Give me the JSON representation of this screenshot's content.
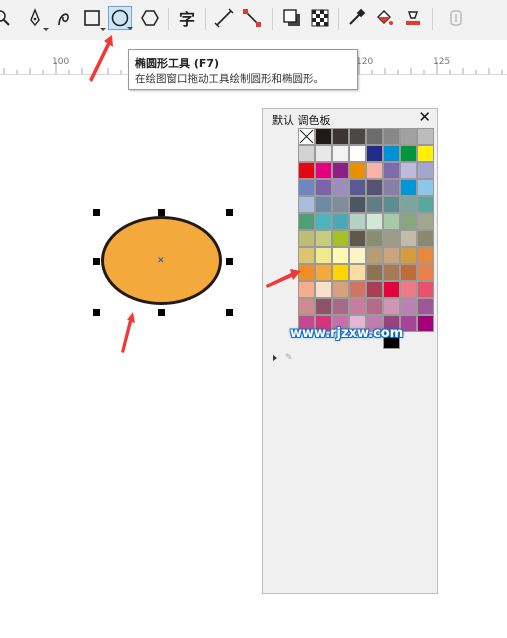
{
  "toolbar": {
    "icons": [
      "zoom-tool",
      "freehand-tool",
      "artistic-media-tool",
      "rectangle-tool",
      "ellipse-tool",
      "polygon-tool",
      "text-tool",
      "parallel-dimension-tool",
      "connector-tool",
      "drop-shadow-tool",
      "transparency-tool",
      "color-eyedropper-tool",
      "interactive-fill-tool",
      "smart-fill-tool",
      "object-lock"
    ],
    "text_tool_glyph": "字",
    "active_tool": "ellipse-tool"
  },
  "ruler": {
    "ticks": [
      "100",
      "120",
      "125"
    ]
  },
  "tooltip": {
    "title": "椭圆形工具 (F7)",
    "description": "在绘图窗口拖动工具绘制圆形和椭圆形。"
  },
  "shape": {
    "fill": "#f4a93c",
    "outline": "#221a14"
  },
  "palette_panel": {
    "title": "默认 调色板",
    "close": "✕",
    "rows": [
      [
        "none",
        "#1f1a17",
        "#3b3634",
        "#4b4847",
        "#6d6c6c",
        "#888787",
        "#a2a1a1",
        "#bcbcbc"
      ],
      [
        "#d2d2d2",
        "#e8e8e8",
        "#f3f3f3",
        "#ffffff",
        "#1e2d89",
        "#0091d5",
        "#00973c",
        "#fff100"
      ],
      [
        "#e30613",
        "#e5007e",
        "#8b2282",
        "#ea8f00",
        "#f5b3a9",
        "#7e6bab",
        "#bfb9dc",
        "#a4a6cf"
      ],
      [
        "#6f86c1",
        "#7d63a9",
        "#9b8ebf",
        "#5a5993",
        "#565272",
        "#867fa6",
        "#0097d7",
        "#8dc6ea"
      ],
      [
        "#a9bedb",
        "#6f8aa6",
        "#7f8c9c",
        "#4c5563",
        "#637e83",
        "#5b8e91",
        "#7aa69d",
        "#58a89f"
      ],
      [
        "#4fa079",
        "#4bb6bd",
        "#4aa8b8",
        "#b3d2c4",
        "#d1e8d7",
        "#a3cba6",
        "#8aa67f",
        "#a4a58d"
      ],
      [
        "#bfbd73",
        "#c7cd7f",
        "#a4c127",
        "#60584b",
        "#8b8e6e",
        "#9e9c88",
        "#c2bca7",
        "#8b8871"
      ],
      [
        "#dac671",
        "#f1ea8c",
        "#fff8b7",
        "#fbf4c9",
        "#b79d73",
        "#c8a57d",
        "#d59c3d",
        "#e7883a"
      ],
      [
        "#f18e26",
        "#f4a93c",
        "#ffd400",
        "#fadca0",
        "#8c7352",
        "#a67a57",
        "#bf6c3b",
        "#e97f4a"
      ],
      [
        "#f5ad8d",
        "#fbe0c9",
        "#d8a17d",
        "#d17563",
        "#ac3d57",
        "#e6003e",
        "#ef7a87",
        "#e8526b"
      ],
      [
        "#cf8a8f",
        "#8e5366",
        "#a76a89",
        "#c87da0",
        "#b46b87",
        "#cf96b4",
        "#b982b1",
        "#9e5797"
      ],
      [
        "#c7488f",
        "#d5357d",
        "#c76fa8",
        "#e5b6d1",
        "#c07dae",
        "#96437f",
        "#a64497",
        "#a3007a"
      ],
      [
        "",
        "",
        "",
        "",
        "",
        "#000000",
        "",
        ""
      ]
    ]
  },
  "watermark": "www.rjzxw.com",
  "annotations": {
    "arrow_color": "#ee3a36"
  }
}
